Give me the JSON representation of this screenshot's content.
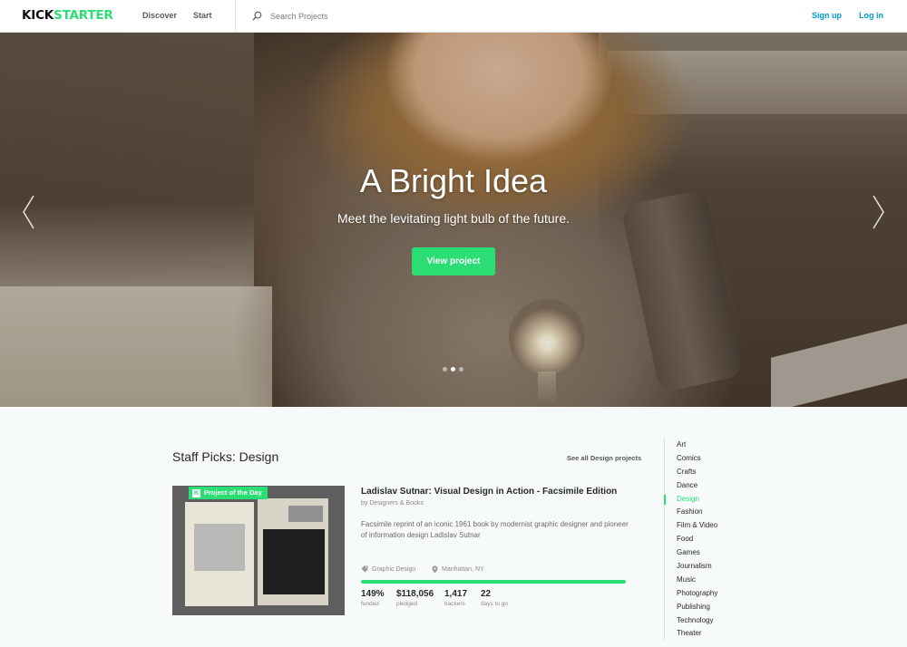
{
  "header": {
    "logo_part1": "KICK",
    "logo_part2": "STARTER",
    "nav": [
      "Discover",
      "Start"
    ],
    "search_placeholder": "Search Projects",
    "signup": "Sign up",
    "login": "Log in"
  },
  "hero": {
    "title": "A Bright Idea",
    "subtitle": "Meet the levitating light bulb of the future.",
    "button": "View project",
    "prev_arrow": "‹",
    "next_arrow": "›",
    "slide_count": 3,
    "active_slide": 2
  },
  "staff_picks": {
    "heading": "Staff Picks: Design",
    "see_all": "See all Design projects",
    "badge": "Project of the Day",
    "badge_icon": "K",
    "project": {
      "title": "Ladislav Sutnar: Visual Design in Action - Facsimile Edition",
      "by": "by Designers & Books",
      "description": "Facsimile reprint of an iconic 1961 book by modernist graphic designer and pioneer of information design Ladislav Sutnar",
      "category": "Graphic Design",
      "location": "Manhattan, NY",
      "progress_percent": 100,
      "stats": [
        {
          "value": "149%",
          "label": "funded"
        },
        {
          "value": "$118,056",
          "label": "pledged"
        },
        {
          "value": "1,417",
          "label": "backers"
        },
        {
          "value": "22",
          "label": "days to go"
        }
      ]
    }
  },
  "categories": {
    "items": [
      "Art",
      "Comics",
      "Crafts",
      "Dance",
      "Design",
      "Fashion",
      "Film & Video",
      "Food",
      "Games",
      "Journalism",
      "Music",
      "Photography",
      "Publishing",
      "Technology",
      "Theater"
    ],
    "active": "Design"
  },
  "colors": {
    "brand_green": "#2bde73",
    "link_blue": "#009ad6"
  },
  "icons": {
    "search": "search-icon",
    "tag": "tag-icon",
    "location": "location-pin-icon"
  }
}
